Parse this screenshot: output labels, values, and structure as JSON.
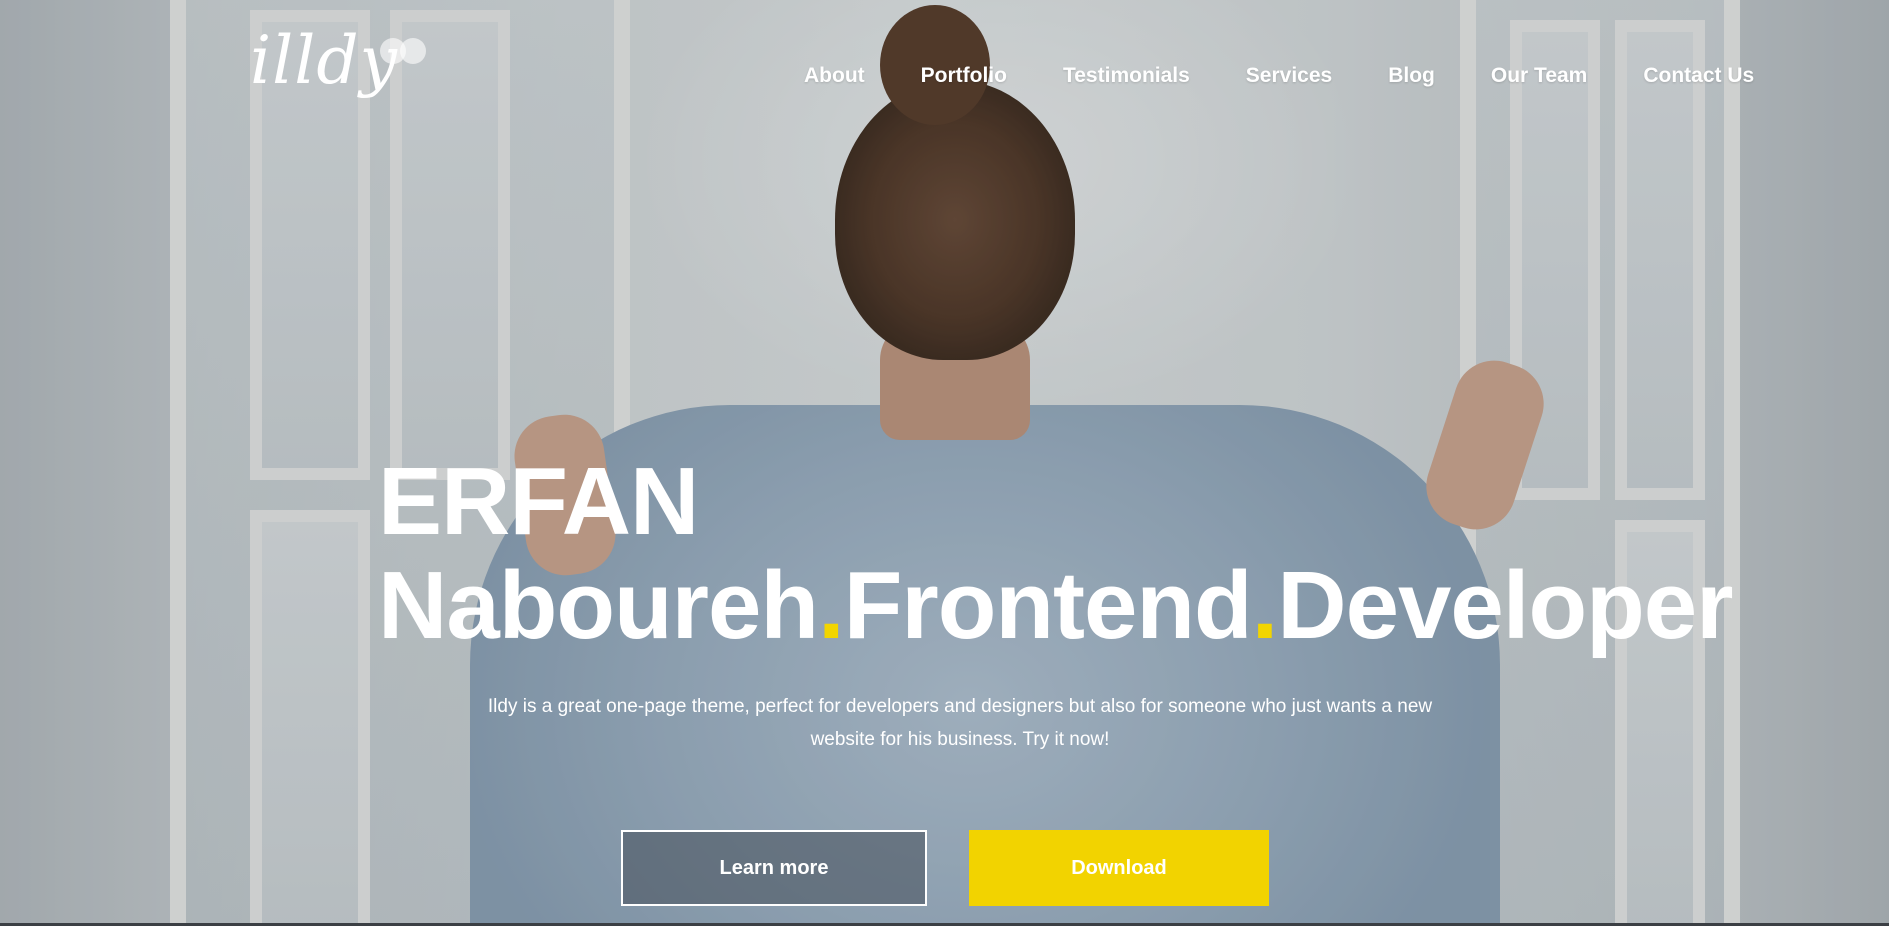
{
  "brand": {
    "logo_text": "illdy"
  },
  "nav": {
    "items": [
      {
        "label": "About"
      },
      {
        "label": "Portfolio"
      },
      {
        "label": "Testimonials"
      },
      {
        "label": "Services"
      },
      {
        "label": "Blog"
      },
      {
        "label": "Our Team"
      },
      {
        "label": "Contact Us"
      }
    ]
  },
  "hero": {
    "headline_line1": "ERFAN",
    "headline_parts": [
      "Naboureh",
      "Frontend",
      "Developer"
    ],
    "separator": ".",
    "subtitle": "Ildy is a great one-page theme, perfect for developers and designers but also for someone who just wants a new website for his business. Try it now!",
    "primary_button": "Learn more",
    "secondary_button": "Download"
  },
  "colors": {
    "accent": "#f2d300",
    "text": "#ffffff"
  }
}
